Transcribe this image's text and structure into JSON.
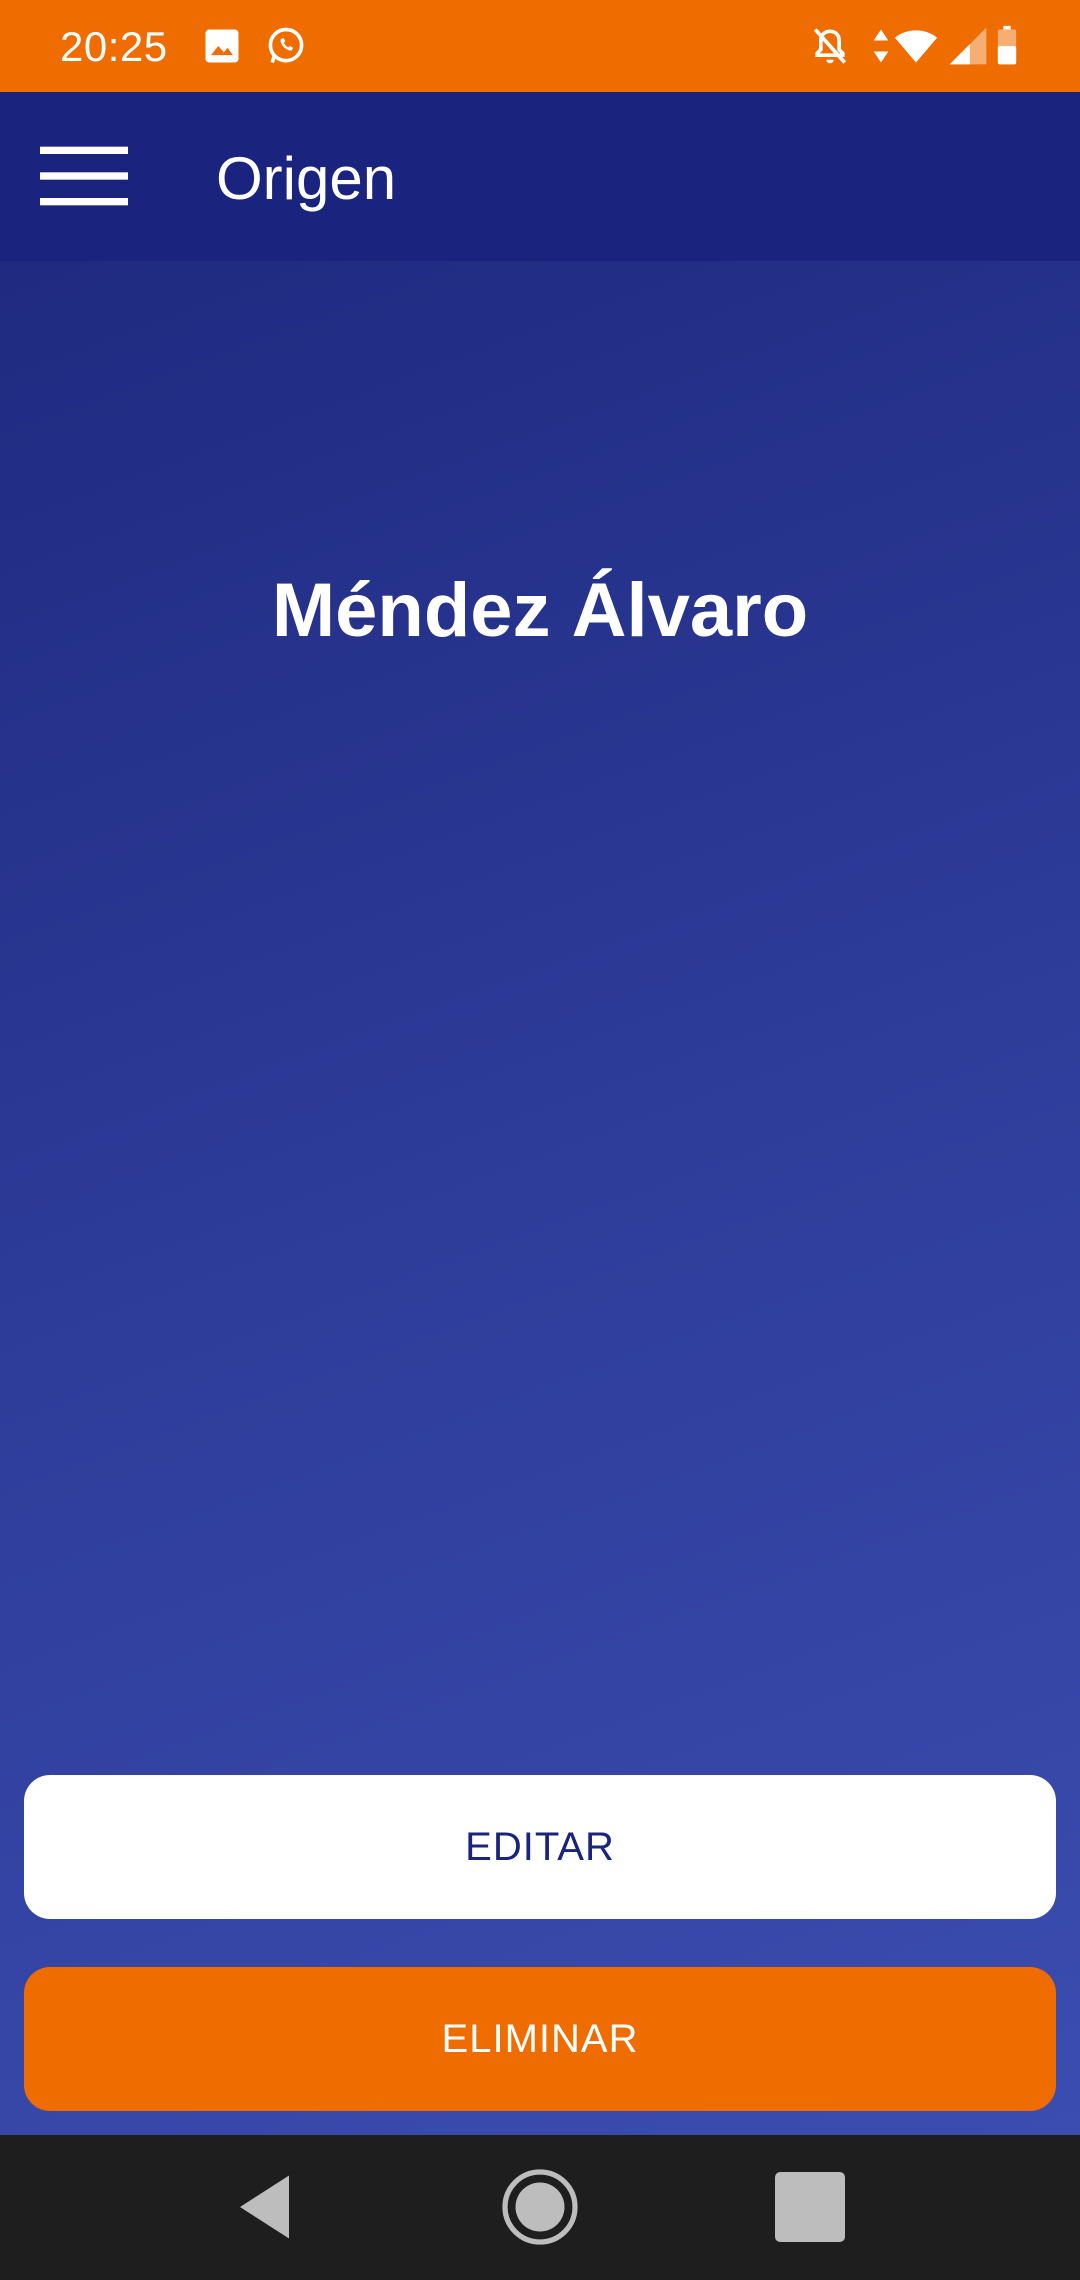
{
  "status_bar": {
    "time": "20:25",
    "background": "#ef6c00",
    "left_icons": [
      "image-icon",
      "whatsapp-icon"
    ],
    "right_icons": [
      "notifications-off-icon",
      "data-arrows-icon",
      "wifi-icon",
      "cell-signal-icon",
      "battery-icon"
    ]
  },
  "app_bar": {
    "title": "Origen",
    "menu_icon": "hamburger-menu-icon",
    "background": "#1a237e"
  },
  "main": {
    "station_name": "Méndez Álvaro",
    "gradient_start": "#1f2a80",
    "gradient_end": "#3b4db0"
  },
  "actions": {
    "edit_label": "EDITAR",
    "delete_label": "ELIMINAR",
    "edit_bg": "#ffffff",
    "delete_bg": "#ef6c00"
  },
  "nav_bar": {
    "buttons": [
      "back-icon",
      "home-icon",
      "recents-icon"
    ]
  }
}
